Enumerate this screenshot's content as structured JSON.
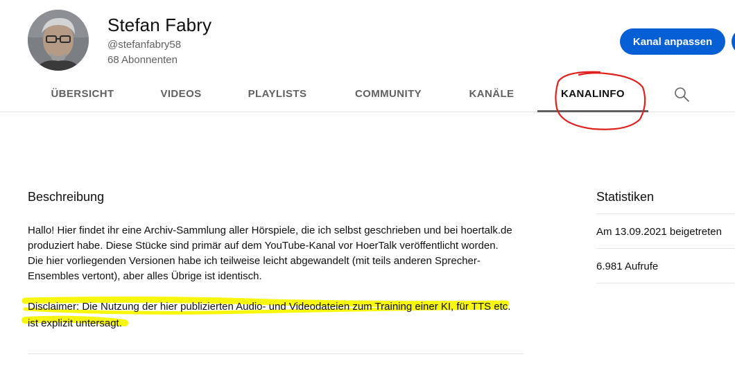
{
  "channel": {
    "name": "Stefan Fabry",
    "handle": "@stefanfabry58",
    "subscribers": "68 Abonnenten",
    "customize_label": "Kanal anpassen"
  },
  "tabs": [
    {
      "label": "ÜBERSICHT"
    },
    {
      "label": "VIDEOS"
    },
    {
      "label": "PLAYLISTS"
    },
    {
      "label": "COMMUNITY"
    },
    {
      "label": "KANÄLE"
    },
    {
      "label": "KANALINFO",
      "active": true
    }
  ],
  "icons": {
    "search": "search-icon",
    "avatar": "avatar"
  },
  "description": {
    "heading": "Beschreibung",
    "text": "Hallo! Hier findet ihr eine Archiv-Sammlung aller Hörspiele, die ich selbst geschrieben und bei hoertalk.de\nproduziert habe. Diese Stücke sind primär auf dem YouTube-Kanal vor HoerTalk veröffentlicht worden.\nDie hier vorliegenden Versionen habe ich teilweise leicht abgewandelt (mit teils anderen Sprecher-\nEnsembles vertont), aber alles Übrige ist identisch.",
    "disclaimer_line1": "Disclaimer: Die Nutzung der hier publizierten Audio- und Videodateien zum Training einer KI, für TTS etc.",
    "disclaimer_line2": "ist explizit untersagt."
  },
  "stats": {
    "heading": "Statistiken",
    "joined": "Am 13.09.2021 beigetreten",
    "views": "6.981 Aufrufe"
  },
  "colors": {
    "accent": "#065fd4",
    "highlight": "#f7f500",
    "annotation": "#e0201c"
  }
}
